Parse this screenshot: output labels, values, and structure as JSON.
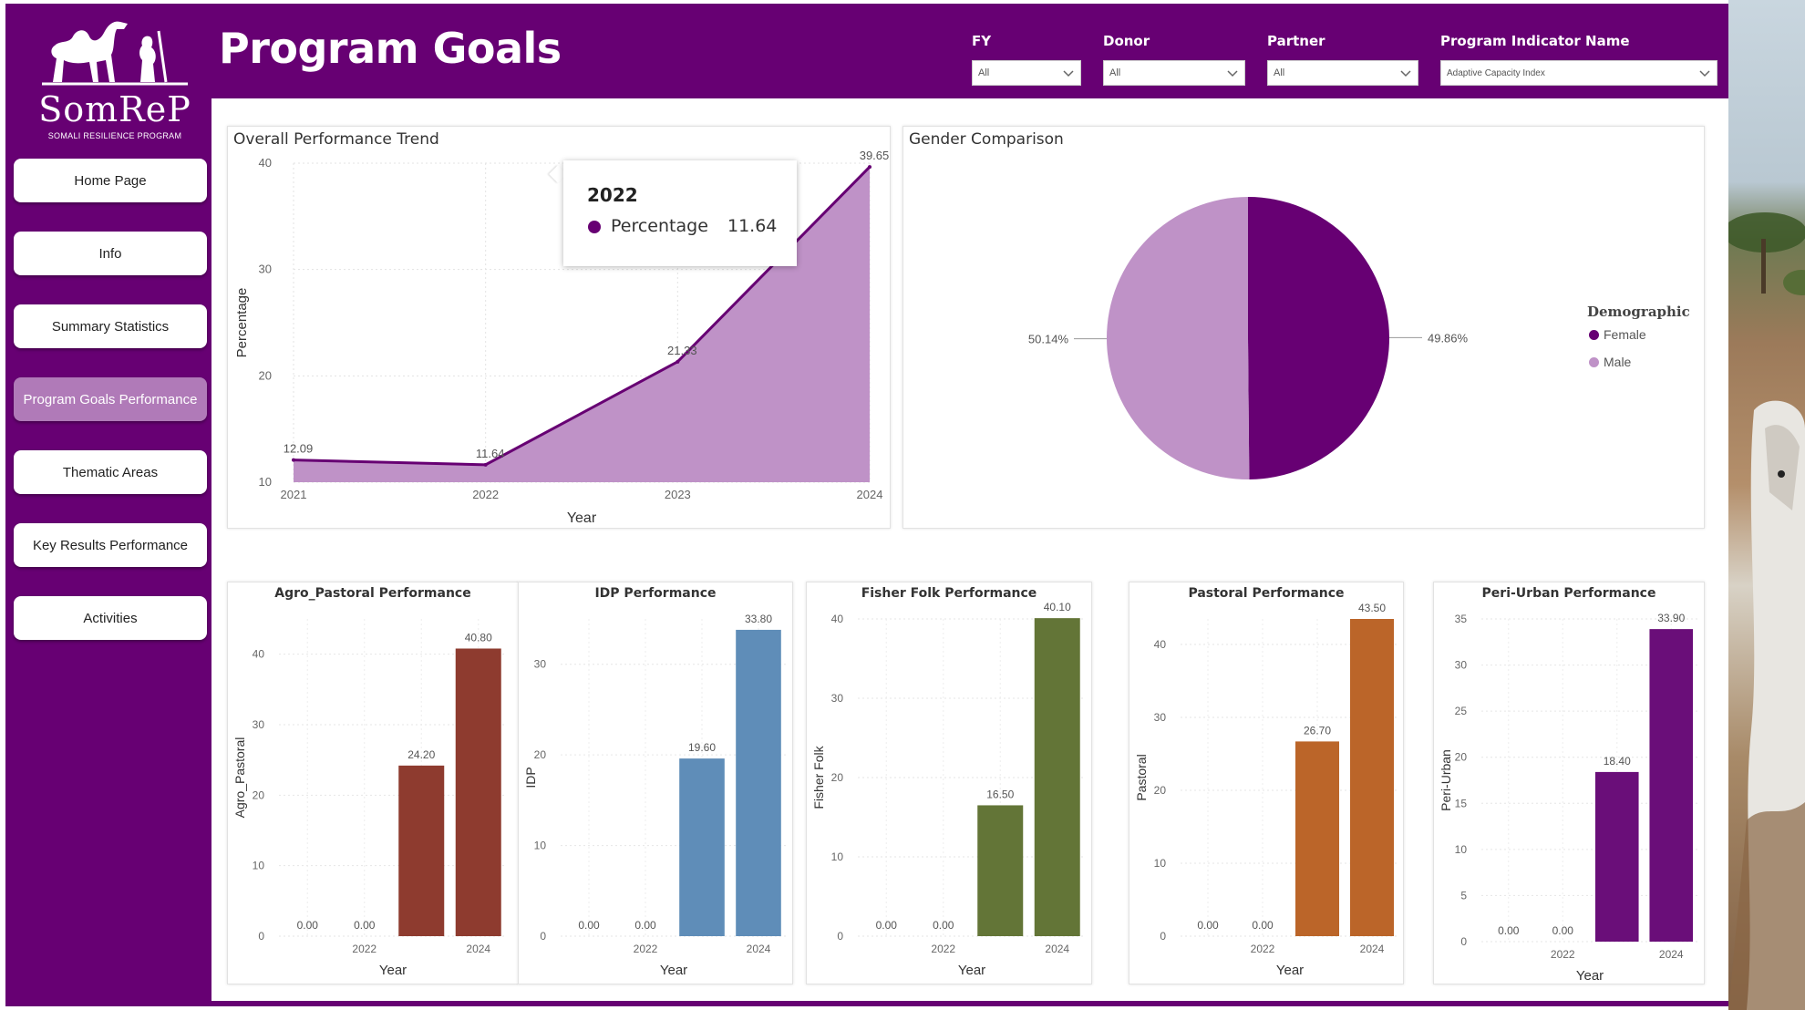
{
  "logo": {
    "name": "SomReP",
    "subtitle": "SOMALI RESILIENCE PROGRAM"
  },
  "page_title": "Program Goals",
  "nav": [
    {
      "label": "Home Page",
      "active": false
    },
    {
      "label": "Info",
      "active": false
    },
    {
      "label": "Summary Statistics",
      "active": false
    },
    {
      "label": "Program Goals Performance",
      "active": true
    },
    {
      "label": "Thematic Areas",
      "active": false
    },
    {
      "label": "Key Results Performance",
      "active": false
    },
    {
      "label": "Activities",
      "active": false
    }
  ],
  "filters": [
    {
      "label": "FY",
      "value": "All"
    },
    {
      "label": "Donor",
      "value": "All"
    },
    {
      "label": "Partner",
      "value": "All"
    },
    {
      "label": "Program Indicator Name",
      "value": "Adaptive Capacity Index"
    }
  ],
  "colors": {
    "brand": "#670073",
    "area_fill": "#bf92c7",
    "female": "#670073",
    "male": "#bf92c7",
    "agro": "#8e3b2f",
    "idp": "#5f8db8",
    "fisher": "#637537",
    "pastoral": "#bb6529",
    "periurban": "#6a0e79"
  },
  "tooltip": {
    "year": "2022",
    "label": "Percentage",
    "value": "11.64"
  },
  "chart_data": [
    {
      "id": "trend",
      "type": "area",
      "title": "Overall Performance Trend",
      "x": [
        "2021",
        "2022",
        "2023",
        "2024"
      ],
      "values": [
        12.09,
        11.64,
        21.33,
        39.65
      ],
      "labels": [
        "12.09",
        "11.64",
        "21.33",
        "39.65"
      ],
      "xlabel": "Year",
      "ylabel": "Percentage",
      "ylim": [
        10,
        40
      ],
      "yticks": [
        10,
        20,
        30,
        40
      ],
      "grid": true
    },
    {
      "id": "gender",
      "type": "pie",
      "title": "Gender Comparison",
      "legend_title": "Demographic",
      "legend_position": "right",
      "slices": [
        {
          "name": "Female",
          "value": 49.86,
          "label": "49.86%"
        },
        {
          "name": "Male",
          "value": 50.14,
          "label": "50.14%"
        }
      ]
    },
    {
      "id": "agro",
      "type": "bar",
      "title": "Agro_Pastoral Performance",
      "categories": [
        "2021",
        "2022",
        "2023",
        "2024"
      ],
      "tick_labels": [
        "",
        "2022",
        "",
        "2024"
      ],
      "values": [
        0,
        0,
        24.2,
        40.8
      ],
      "labels": [
        "0.00",
        "0.00",
        "24.20",
        "40.80"
      ],
      "xlabel": "Year",
      "ylabel": "Agro_Pastoral",
      "ylim": [
        0,
        45
      ],
      "yticks": [
        0,
        10,
        20,
        30,
        40
      ]
    },
    {
      "id": "idp",
      "type": "bar",
      "title": "IDP Performance",
      "categories": [
        "2021",
        "2022",
        "2023",
        "2024"
      ],
      "tick_labels": [
        "",
        "2022",
        "",
        "2024"
      ],
      "values": [
        0,
        0,
        19.6,
        33.8
      ],
      "labels": [
        "0.00",
        "0.00",
        "19.60",
        "33.80"
      ],
      "xlabel": "Year",
      "ylabel": "IDP",
      "ylim": [
        0,
        35
      ],
      "yticks": [
        0,
        10,
        20,
        30
      ]
    },
    {
      "id": "fisher",
      "type": "bar",
      "title": "Fisher Folk Performance",
      "categories": [
        "2021",
        "2022",
        "2023",
        "2024"
      ],
      "tick_labels": [
        "",
        "2022",
        "",
        "2024"
      ],
      "values": [
        0,
        0,
        16.5,
        40.1
      ],
      "labels": [
        "0.00",
        "0.00",
        "16.50",
        "40.10"
      ],
      "xlabel": "Year",
      "ylabel": "Fisher Folk",
      "ylim": [
        0,
        40
      ],
      "yticks": [
        0,
        10,
        20,
        30,
        40
      ]
    },
    {
      "id": "pastoral",
      "type": "bar",
      "title": "Pastoral Performance",
      "categories": [
        "2021",
        "2022",
        "2023",
        "2024"
      ],
      "tick_labels": [
        "",
        "2022",
        "",
        "2024"
      ],
      "values": [
        0,
        0,
        26.7,
        43.5
      ],
      "labels": [
        "0.00",
        "0.00",
        "26.70",
        "43.50"
      ],
      "xlabel": "Year",
      "ylabel": "Pastoral",
      "ylim": [
        0,
        43.5
      ],
      "yticks": [
        0,
        10,
        20,
        30,
        40
      ]
    },
    {
      "id": "periurban",
      "type": "bar",
      "title": "Peri-Urban Performance",
      "categories": [
        "2021",
        "2022",
        "2023",
        "2024"
      ],
      "tick_labels": [
        "",
        "2022",
        "",
        "2024"
      ],
      "values": [
        0,
        0,
        18.4,
        33.9
      ],
      "labels": [
        "0.00",
        "0.00",
        "18.40",
        "33.90"
      ],
      "xlabel": "Year",
      "ylabel": "Peri-Urban",
      "ylim": [
        0,
        35
      ],
      "yticks": [
        0,
        5,
        10,
        15,
        20,
        25,
        30,
        35
      ]
    }
  ]
}
